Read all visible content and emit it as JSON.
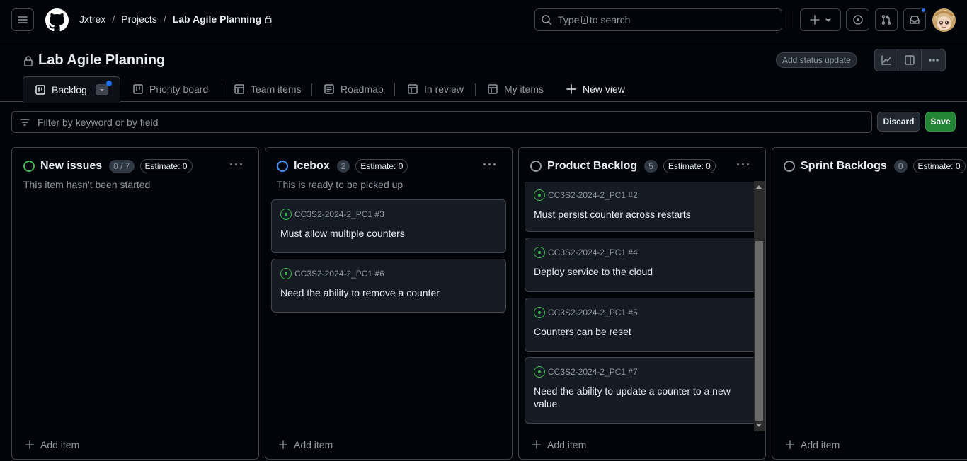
{
  "header": {
    "breadcrumbs": [
      "Jxtrex",
      "Projects",
      "Lab Agile Planning"
    ],
    "breadcrumb_separator": "/",
    "search_placeholder_before": "Type",
    "search_key": "/",
    "search_placeholder_after": "to search"
  },
  "project": {
    "title": "Lab Agile Planning",
    "status_update_label": "Add status update"
  },
  "tabs": [
    {
      "label": "Backlog",
      "icon": "board-icon"
    },
    {
      "label": "Priority board",
      "icon": "board-icon"
    },
    {
      "label": "Team items",
      "icon": "table-icon"
    },
    {
      "label": "Roadmap",
      "icon": "roadmap-icon"
    },
    {
      "label": "In review",
      "icon": "table-icon"
    },
    {
      "label": "My items",
      "icon": "table-icon"
    },
    {
      "label": "New view",
      "icon": "plus-icon"
    }
  ],
  "filter": {
    "placeholder": "Filter by keyword or by field",
    "discard_label": "Discard",
    "save_label": "Save"
  },
  "columns": [
    {
      "name": "New issues",
      "count": "0 / 7",
      "estimate": "Estimate: 0",
      "color": "#3fb950",
      "description": "This item hasn't been started",
      "add_label": "Add item",
      "cards": []
    },
    {
      "name": "Icebox",
      "count": "2",
      "estimate": "Estimate: 0",
      "color": "#4493f8",
      "description": "This is ready to be picked up",
      "add_label": "Add item",
      "cards": [
        {
          "ref": "CC3S2-2024-2_PC1 #3",
          "title": "Must allow multiple counters"
        },
        {
          "ref": "CC3S2-2024-2_PC1 #6",
          "title": "Need the ability to remove a counter"
        }
      ]
    },
    {
      "name": "Product Backlog",
      "count": "5",
      "estimate": "Estimate: 0",
      "color": "#9198a1",
      "description": "",
      "add_label": "Add item",
      "cards": [
        {
          "ref": "CC3S2-2024-2_PC1 #2",
          "title": "Must persist counter across restarts"
        },
        {
          "ref": "CC3S2-2024-2_PC1 #4",
          "title": "Deploy service to the cloud"
        },
        {
          "ref": "CC3S2-2024-2_PC1 #5",
          "title": "Counters can be reset"
        },
        {
          "ref": "CC3S2-2024-2_PC1 #7",
          "title": "Need the ability to update a counter to a new value"
        }
      ]
    },
    {
      "name": "Sprint Backlogs",
      "count": "0",
      "estimate": "Estimate: 0",
      "color": "#9198a1",
      "description": "",
      "add_label": "Add item",
      "cards": []
    }
  ],
  "colors": {
    "background": "#010409",
    "border": "#3d444d",
    "accent_blue": "#1f6feb",
    "save_green": "#238636",
    "issue_open_green": "#3fb950"
  }
}
